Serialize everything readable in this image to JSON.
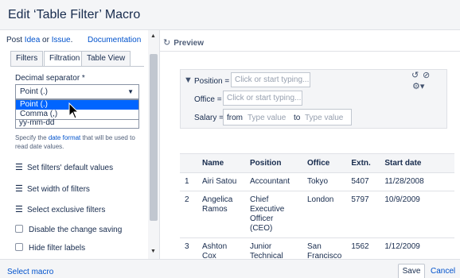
{
  "dialog": {
    "title": "Edit ‘Table Filter’ Macro"
  },
  "left": {
    "post_prefix": "Post ",
    "idea_link": "Idea",
    "or_text": " or ",
    "issue_link": "Issue",
    "period": ".",
    "documentation_link": "Documentation",
    "tabs": [
      {
        "label": "Filters",
        "active": false
      },
      {
        "label": "Filtration",
        "active": true
      },
      {
        "label": "Table View",
        "active": false
      }
    ],
    "decimal_label": "Decimal separator *",
    "decimal_value": "Point (.)",
    "dropdown_options": [
      {
        "label": "Point (.)",
        "selected": true
      },
      {
        "label": "Comma (,)",
        "selected": false
      }
    ],
    "date_format_value": "yy-mm-dd",
    "help_prefix": "Specify the ",
    "help_link": "date format",
    "help_suffix": " that will be used to read date values.",
    "options": [
      {
        "icon": "list-icon",
        "label": "Set filters' default values"
      },
      {
        "icon": "list-icon",
        "label": "Set width of filters"
      },
      {
        "icon": "list-icon",
        "label": "Select exclusive filters"
      }
    ],
    "checkboxes": [
      {
        "label": "Disable the change saving",
        "checked": false
      },
      {
        "label": "Hide filter labels",
        "checked": false
      }
    ]
  },
  "preview": {
    "header": "Preview",
    "filters": {
      "position_label": "Position =",
      "position_placeholder": "Click or start typing...",
      "office_label": "Office =",
      "office_placeholder": "Click or start typing...",
      "salary_label": "Salary =",
      "from_label": "from",
      "from_placeholder": "Type value",
      "to_label": "to",
      "to_placeholder": "Type value"
    },
    "table": {
      "headers": [
        "",
        "Name",
        "Position",
        "Office",
        "Extn.",
        "Start date"
      ],
      "rows": [
        [
          "1",
          "Airi Satou",
          "Accountant",
          "Tokyo",
          "5407",
          "11/28/2008"
        ],
        [
          "2",
          "Angelica Ramos",
          "Chief Executive Officer (CEO)",
          "London",
          "5797",
          "10/9/2009"
        ],
        [
          "3",
          "Ashton Cox",
          "Junior Technical",
          "San Francisco",
          "1562",
          "1/12/2009"
        ]
      ]
    }
  },
  "footer": {
    "select_macro": "Select macro",
    "save": "Save",
    "cancel": "Cancel"
  }
}
